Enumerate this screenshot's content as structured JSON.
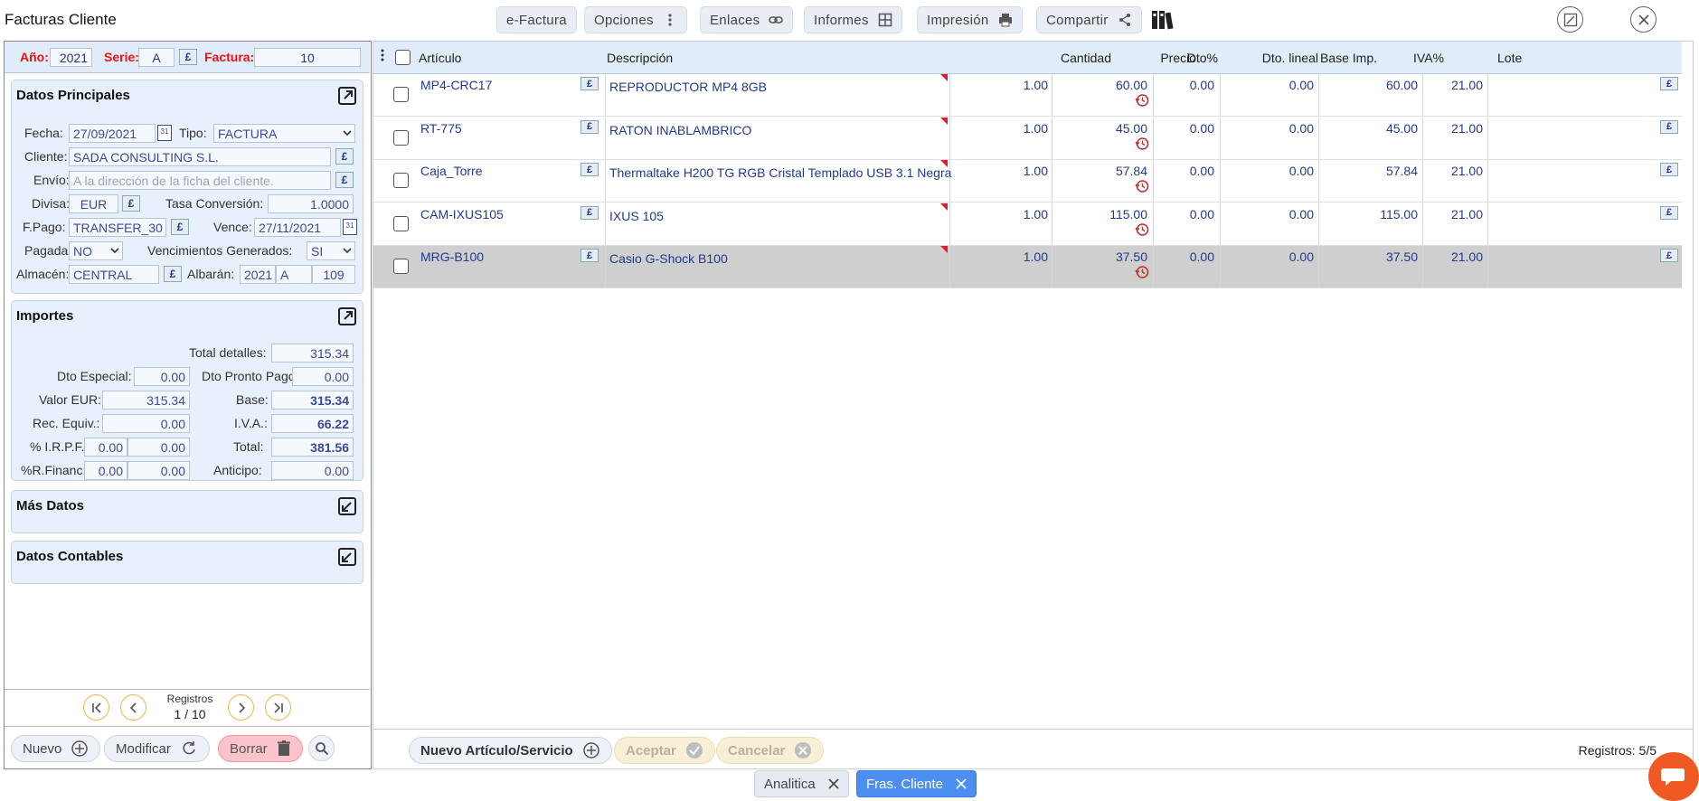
{
  "window": {
    "title": "Facturas Cliente"
  },
  "toolbar": {
    "efactura": "e-Factura",
    "opciones": "Opciones",
    "enlaces": "Enlaces",
    "informes": "Informes",
    "impresion": "Impresión",
    "compartir": "Compartir"
  },
  "header": {
    "anio_label": "Año:",
    "anio": "2021",
    "serie_label": "Serie:",
    "serie": "A",
    "factura_label": "Factura:",
    "factura": "10"
  },
  "datos": {
    "title": "Datos Principales",
    "fecha_label": "Fecha:",
    "fecha": "27/09/2021",
    "tipo_label": "Tipo:",
    "tipo": "FACTURA",
    "cliente_label": "Cliente:",
    "cliente": "SADA CONSULTING S.L.",
    "envio_label": "Envío:",
    "envio_ph": "A la dirección de la ficha del cliente.",
    "divisa_label": "Divisa:",
    "divisa": "EUR",
    "tasa_label": "Tasa Conversión:",
    "tasa": "1.0000",
    "fpago_label": "F.Pago:",
    "fpago": "TRANSFER_30",
    "vence_label": "Vence:",
    "vence": "27/11/2021",
    "pagada_label": "Pagada:",
    "pagada": "NO",
    "venc_label": "Vencimientos Generados:",
    "venc": "SI",
    "almacen_label": "Almacén:",
    "almacen": "CENTRAL",
    "albaran_label": "Albarán:",
    "alb_anio": "2021",
    "alb_serie": "A",
    "alb_num": "109"
  },
  "importes": {
    "title": "Importes",
    "total_det_label": "Total detalles:",
    "total_det": "315.34",
    "dto_esp_label": "Dto Especial:",
    "dto_esp": "0.00",
    "dto_pp_label": "Dto Pronto Pago:",
    "dto_pp": "0.00",
    "valor_label": "Valor EUR:",
    "valor": "315.34",
    "base_label": "Base:",
    "base": "315.34",
    "rec_label": "Rec. Equiv.:",
    "rec": "0.00",
    "iva_label": "I.V.A.:",
    "iva": "66.22",
    "irpf_label": "% I.R.P.F.:",
    "irpf1": "0.00",
    "irpf2": "0.00",
    "total_label": "Total:",
    "total": "381.56",
    "rfin_label": "%R.Financ:",
    "rfin1": "0.00",
    "rfin2": "0.00",
    "anticipo_label": "Anticipo:",
    "anticipo": "0.00"
  },
  "mas": {
    "title": "Más Datos"
  },
  "contables": {
    "title": "Datos Contables"
  },
  "nav": {
    "label": "Registros",
    "count": "1 / 10"
  },
  "actions": {
    "nuevo": "Nuevo",
    "modificar": "Modificar",
    "borrar": "Borrar"
  },
  "grid": {
    "cols": [
      "Artículo",
      "Descripción",
      "Cantidad",
      "Precio",
      "Dto%",
      "Dto. lineal",
      "Base Imp.",
      "IVA%",
      "Lote"
    ],
    "rows": [
      {
        "art": "MP4-CRC17",
        "desc": "REPRODUCTOR MP4 8GB",
        "cant": "1.00",
        "precio": "60.00",
        "dto": "0.00",
        "dtol": "0.00",
        "base": "60.00",
        "iva": "21.00"
      },
      {
        "art": "RT-775",
        "desc": "RATON INABLAMBRICO",
        "cant": "1.00",
        "precio": "45.00",
        "dto": "0.00",
        "dtol": "0.00",
        "base": "45.00",
        "iva": "21.00"
      },
      {
        "art": "Caja_Torre",
        "desc": "Thermaltake H200 TG RGB Cristal Templado USB 3.1 Negra",
        "cant": "1.00",
        "precio": "57.84",
        "dto": "0.00",
        "dtol": "0.00",
        "base": "57.84",
        "iva": "21.00"
      },
      {
        "art": "CAM-IXUS105",
        "desc": "IXUS 105",
        "cant": "1.00",
        "precio": "115.00",
        "dto": "0.00",
        "dtol": "0.00",
        "base": "115.00",
        "iva": "21.00"
      },
      {
        "art": "MRG-B100",
        "desc": "Casio G-Shock B100",
        "cant": "1.00",
        "precio": "37.50",
        "dto": "0.00",
        "dtol": "0.00",
        "base": "37.50",
        "iva": "21.00"
      }
    ]
  },
  "footer": {
    "nuevo_art": "Nuevo Artículo/Servicio",
    "aceptar": "Aceptar",
    "cancelar": "Cancelar",
    "registros": "Registros: 5/5"
  },
  "tabs": {
    "analitica": "Analitica",
    "fras": "Fras. Cliente"
  }
}
